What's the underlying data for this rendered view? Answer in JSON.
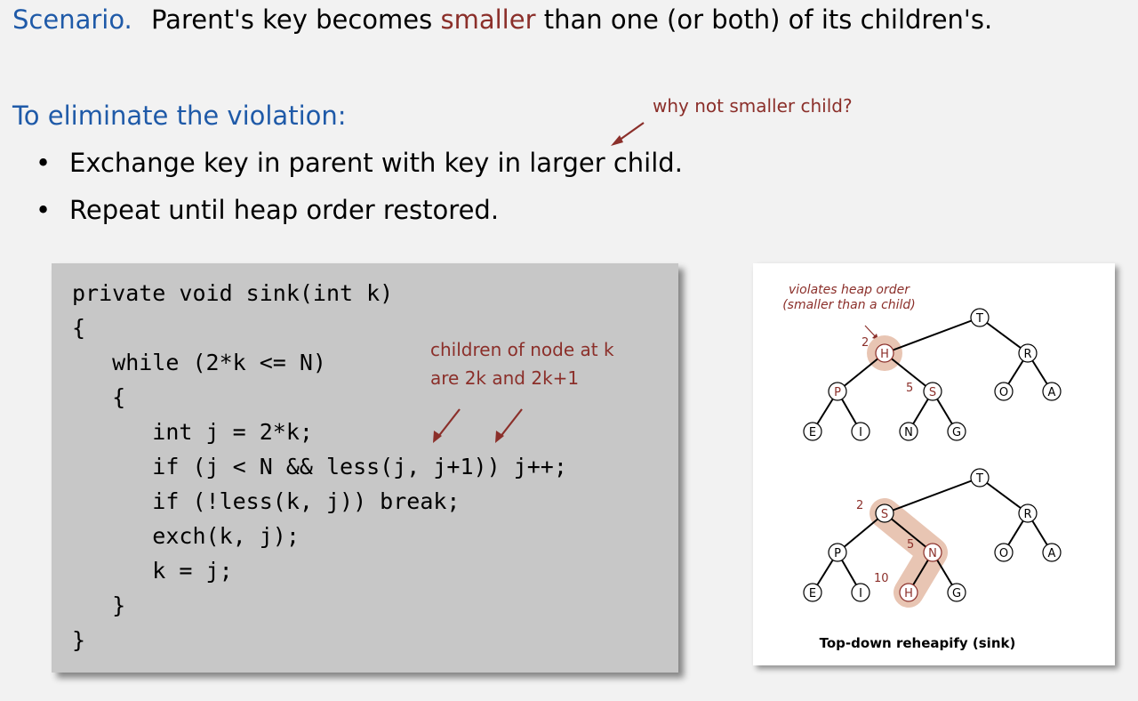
{
  "scenario": {
    "label": "Scenario.",
    "text_before": "Parent's key becomes ",
    "highlight": "smaller",
    "text_after": " than one (or both) of its children's."
  },
  "eliminate": {
    "heading": "To eliminate the violation:",
    "annotation": "why not smaller child?",
    "bullets": [
      "Exchange key in parent with key in larger child.",
      "Repeat until heap order restored."
    ]
  },
  "code": {
    "lines": [
      "private void sink(int k)",
      "{",
      "   while (2*k <= N)",
      "   {",
      "      int j = 2*k;",
      "      if (j < N && less(j, j+1)) j++;",
      "      if (!less(k, j)) break;",
      "      exch(k, j);",
      "      k = j;",
      "   }",
      "}"
    ],
    "note_line1": "children of node at k",
    "note_line2": "are 2k and 2k+1"
  },
  "diagram": {
    "note_line1": "violates heap order",
    "note_line2": "(smaller than a child)",
    "caption": "Top-down reheapify (sink)",
    "tree_before": [
      "T",
      "H",
      "R",
      "P",
      "S",
      "O",
      "A",
      "E",
      "I",
      "N",
      "G"
    ],
    "tree_after": [
      "T",
      "S",
      "R",
      "P",
      "N",
      "O",
      "A",
      "E",
      "I",
      "H",
      "G"
    ],
    "index_labels_before": [
      "2",
      "5"
    ],
    "index_labels_after": [
      "2",
      "5",
      "10"
    ]
  },
  "colors": {
    "blue": "#1f5aa8",
    "red": "#8b2f2a",
    "highlight": "#e8c5b3",
    "code_bg": "#c7c7c7"
  }
}
